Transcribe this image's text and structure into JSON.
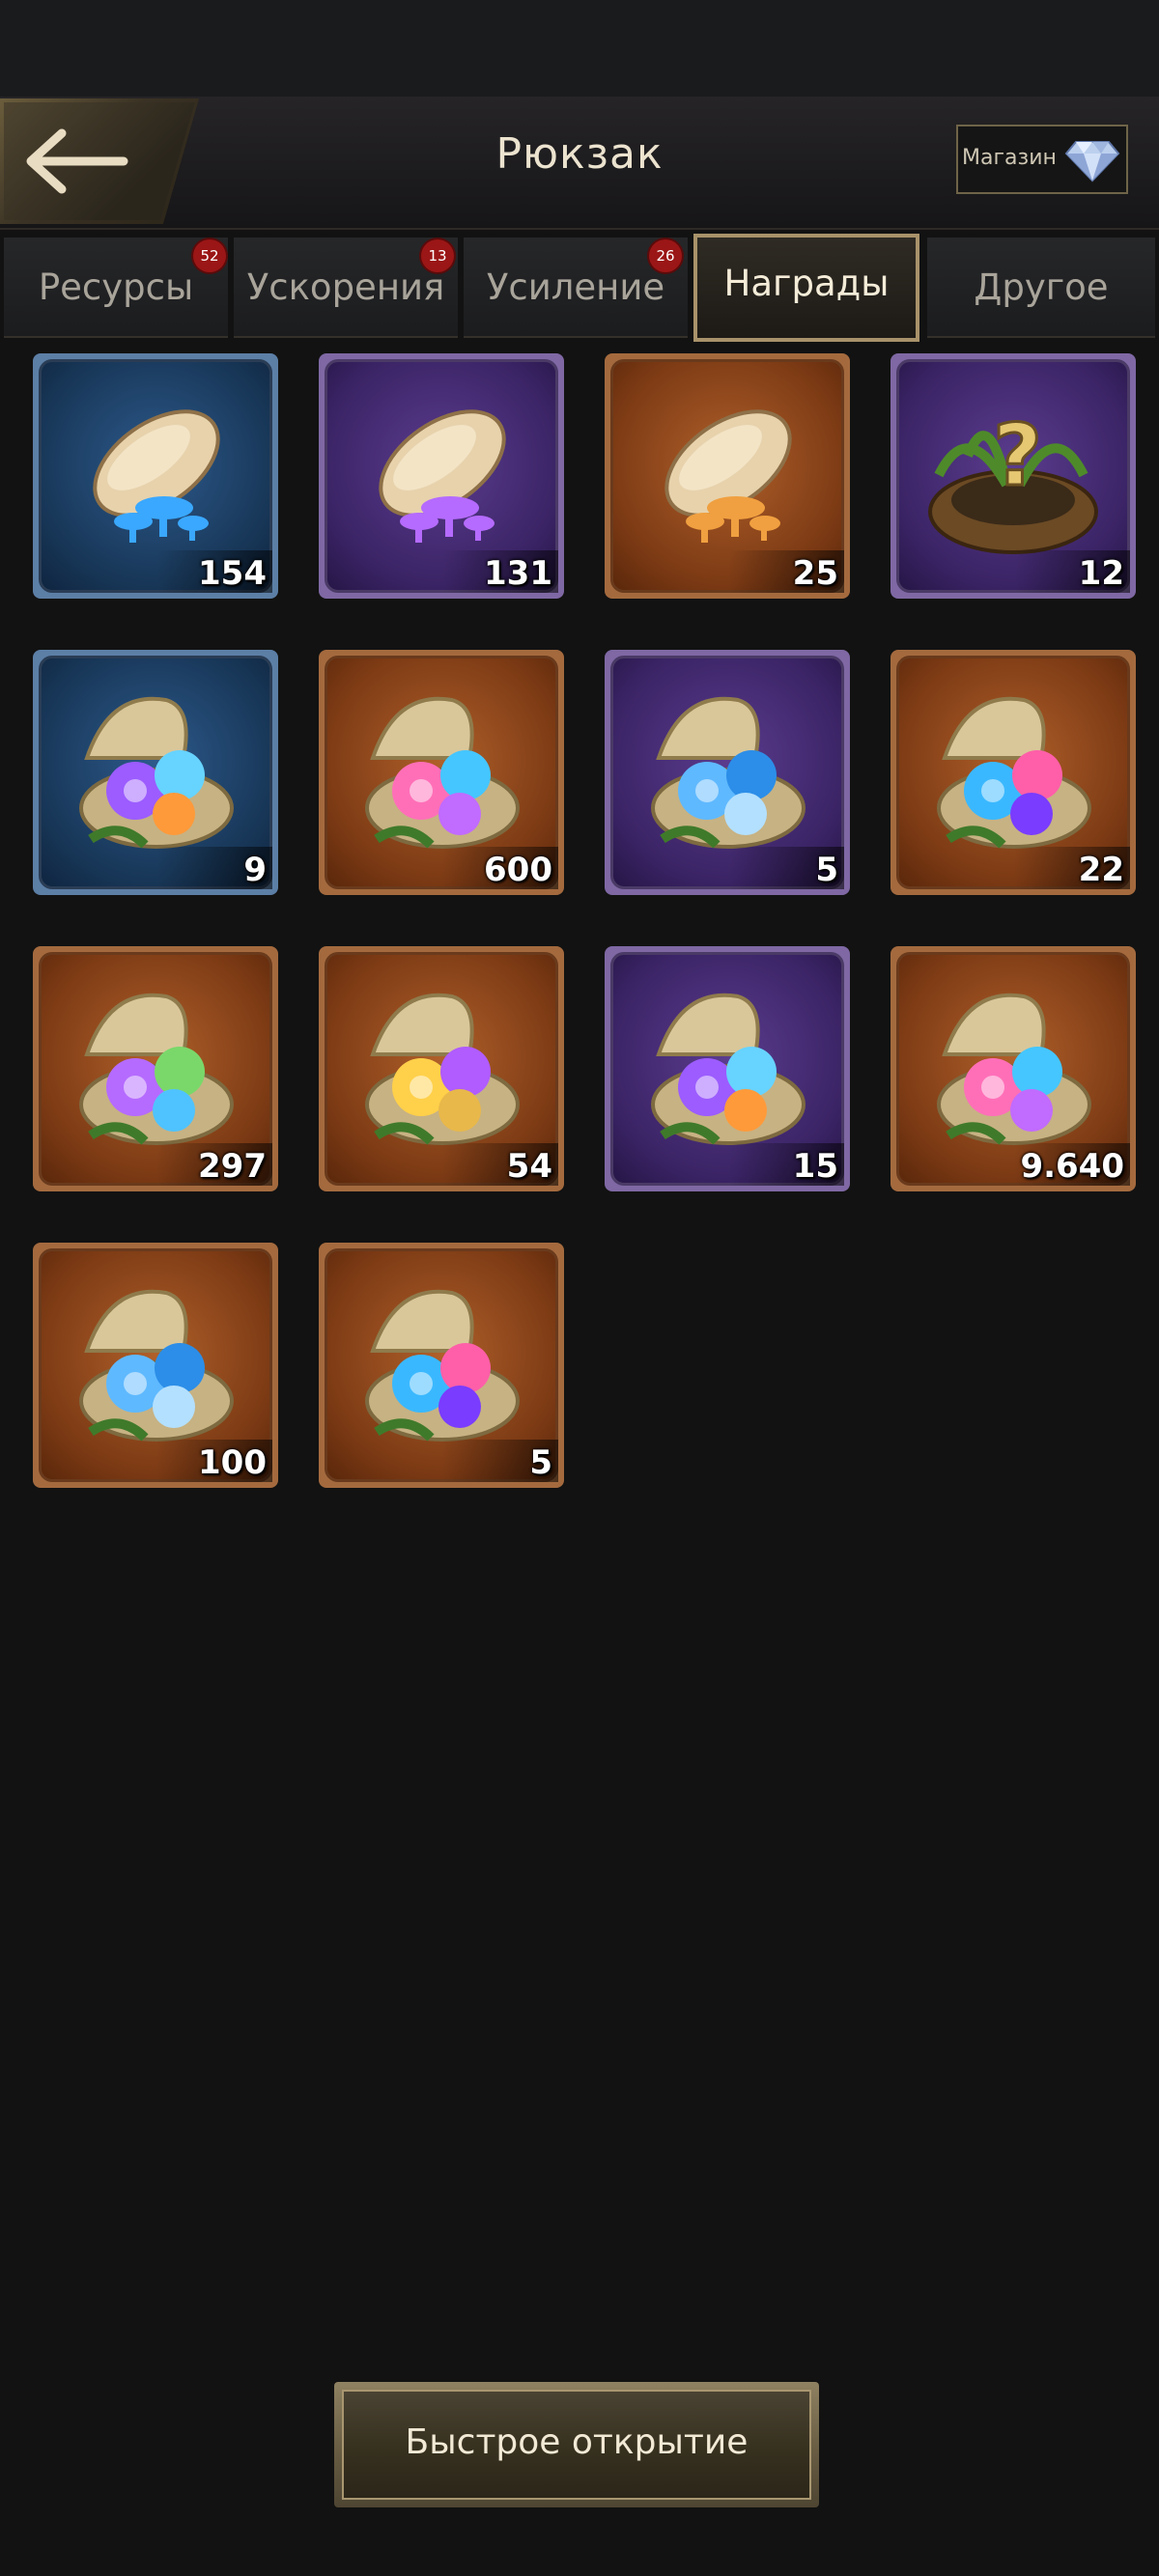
{
  "header": {
    "title": "Рюкзак",
    "shop_label": "Магазин"
  },
  "tabs": [
    {
      "label": "Ресурсы",
      "badge": "52",
      "active": false
    },
    {
      "label": "Ускорения",
      "badge": "13",
      "active": false
    },
    {
      "label": "Усиление",
      "badge": "26",
      "active": false
    },
    {
      "label": "Награды",
      "badge": "",
      "active": true
    },
    {
      "label": "Другое",
      "badge": "",
      "active": false
    }
  ],
  "items": [
    {
      "icon": "blue-mushroom-seed-icon",
      "frame": "blue",
      "count": "154"
    },
    {
      "icon": "purple-mushroom-seed-icon",
      "frame": "purple",
      "count": "131"
    },
    {
      "icon": "orange-mushroom-seed-icon",
      "frame": "orange",
      "count": "25"
    },
    {
      "icon": "mystery-nest-icon",
      "frame": "purple",
      "count": "12"
    },
    {
      "icon": "shell-with-soil-and-larva-icon",
      "frame": "blue",
      "count": "9"
    },
    {
      "icon": "shell-with-spores-icon",
      "frame": "orange",
      "count": "600"
    },
    {
      "icon": "shell-with-blue-spores-icon",
      "frame": "purple",
      "count": "5"
    },
    {
      "icon": "shell-with-dna-and-spores-icon",
      "frame": "orange",
      "count": "22"
    },
    {
      "icon": "shell-with-golden-spores-icon",
      "frame": "orange",
      "count": "297"
    },
    {
      "icon": "shell-with-badge-and-mushrooms-icon",
      "frame": "orange",
      "count": "54"
    },
    {
      "icon": "shell-with-pink-spores-icon",
      "frame": "purple",
      "count": "15"
    },
    {
      "icon": "open-shell-with-pink-spores-icon",
      "frame": "orange",
      "count": "9.640"
    },
    {
      "icon": "shell-with-purple-dna-icon",
      "frame": "orange",
      "count": "100"
    },
    {
      "icon": "shell-with-butterfly-puzzle-icon",
      "frame": "orange",
      "count": "5"
    }
  ],
  "footer": {
    "quick_open_label": "Быстрое открытие"
  },
  "colors": {
    "background": "#121212",
    "accent_gold": "#a8926a",
    "badge_red": "#9b1616"
  }
}
